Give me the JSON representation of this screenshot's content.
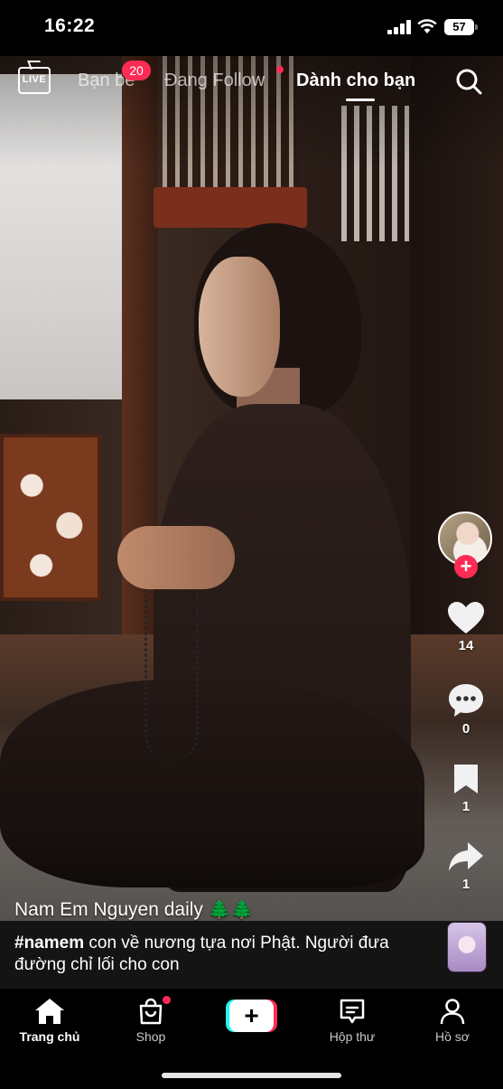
{
  "status_bar": {
    "time": "16:22",
    "battery": "57"
  },
  "top_nav": {
    "live_label": "LIVE",
    "tabs": [
      {
        "label": "Bạn bè",
        "badge": "20"
      },
      {
        "label": "Đang Follow"
      },
      {
        "label": "Dành cho bạn",
        "active": true
      }
    ]
  },
  "actions": {
    "likes": "14",
    "comments": "0",
    "bookmarks": "1",
    "shares": "1"
  },
  "post": {
    "author": "Nam Em Nguyen daily",
    "author_emoji": "🌲🌲",
    "hashtag": "#namem",
    "caption": " con về nương tựa nơi Phật. Người đưa đường chỉ lối cho con"
  },
  "bottom_nav": {
    "items": [
      {
        "label": "Trang chủ",
        "active": true
      },
      {
        "label": "Shop"
      },
      {
        "label": "+"
      },
      {
        "label": "Hộp thư"
      },
      {
        "label": "Hồ sơ"
      }
    ]
  },
  "colors": {
    "accent_red": "#fe2c55",
    "accent_cyan": "#25f4ee"
  }
}
